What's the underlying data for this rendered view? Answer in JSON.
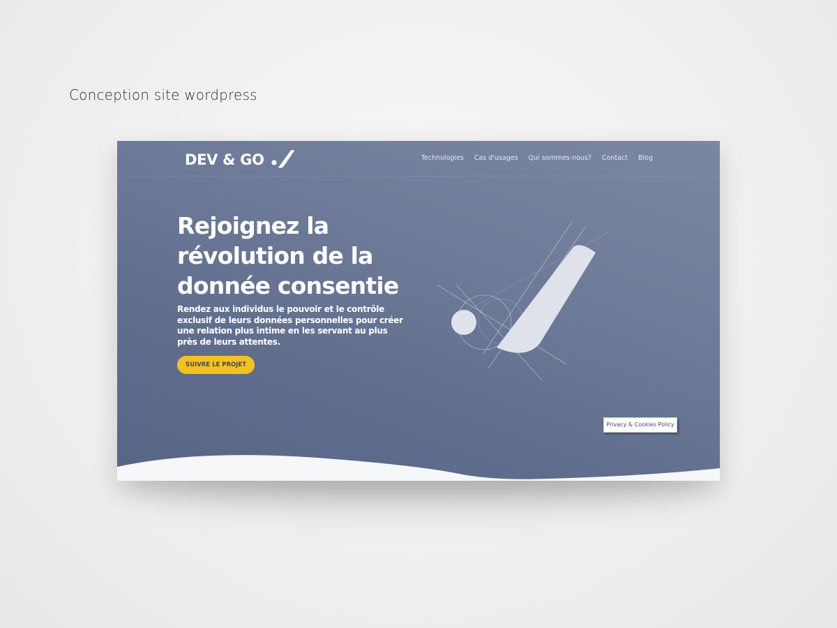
{
  "page_caption": "Conception site wordpress",
  "site": {
    "logo_text": "DEV & GO",
    "nav": [
      "Technologies",
      "Cas d'usages",
      "Qui sommes-nous?",
      "Contact",
      "Blog"
    ],
    "hero": {
      "title": "Rejoignez la révolution de la donnée consentie",
      "subtitle": "Rendez aux individus le pouvoir et le contrôle exclusif de leurs données personnelles  pour créer une relation plus intime en les servant au plus près de leurs attentes.",
      "cta_label": "SUIVRE LE PROJET"
    },
    "privacy_label": "Privacy & Cookies Policy"
  },
  "colors": {
    "hero_gradient_top": "#7b87a2",
    "hero_gradient_bottom": "#566487",
    "accent_yellow": "#f5c21b",
    "text_white": "#ffffff"
  },
  "icons": {
    "logo_mark": "checkmark-dot-icon",
    "hero_illustration": "brand-mark-construction-illustration"
  }
}
